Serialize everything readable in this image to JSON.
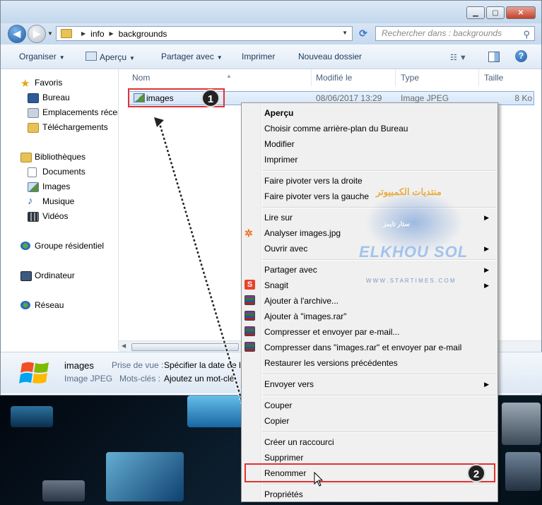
{
  "window": {
    "nav_back_icon": "back-arrow-icon",
    "nav_forward_icon": "forward-arrow-icon",
    "breadcrumb": [
      "info",
      "backgrounds"
    ],
    "search_placeholder": "Rechercher dans : backgrounds",
    "buttons": {
      "minimize": "▁",
      "maximize": "▢",
      "close": "✕"
    }
  },
  "toolbar": {
    "organise": "Organiser",
    "preview": "Aperçu",
    "share": "Partager avec",
    "print": "Imprimer",
    "new_folder": "Nouveau dossier"
  },
  "sidebar": {
    "favorites": "Favoris",
    "favorites_items": [
      "Bureau",
      "Emplacements récen",
      "Téléchargements"
    ],
    "libraries": "Bibliothèques",
    "libraries_items": [
      "Documents",
      "Images",
      "Musique",
      "Vidéos"
    ],
    "homegroup": "Groupe résidentiel",
    "computer": "Ordinateur",
    "network": "Réseau"
  },
  "columns": [
    "Nom",
    "Modifié le",
    "Type",
    "Taille"
  ],
  "file": {
    "name": "images",
    "modified": "08/06/2017 13:29",
    "type": "Image JPEG",
    "size": "8 Ko"
  },
  "details": {
    "name": "images",
    "type": "Image JPEG",
    "taken_label": "Prise de vue :",
    "taken_value": "Spécifier la date de la",
    "tags_label": "Mots-clés :",
    "tags_value": "Ajoutez un mot-clé"
  },
  "context_menu": {
    "preview": "Aperçu",
    "set_background": "Choisir comme arrière-plan du Bureau",
    "edit": "Modifier",
    "print": "Imprimer",
    "rotate_right": "Faire pivoter vers la droite",
    "rotate_left": "Faire pivoter vers la gauche",
    "play_on": "Lire sur",
    "scan": "Analyser images.jpg",
    "open_with": "Ouvrir avec",
    "share_with": "Partager avec",
    "snagit": "Snagit",
    "add_archive": "Ajouter à l'archive...",
    "add_rar": "Ajouter à \"images.rar\"",
    "compress_email": "Compresser et envoyer par e-mail...",
    "compress_rar_email": "Compresser dans \"images.rar\" et envoyer par e-mail",
    "restore": "Restaurer les versions précédentes",
    "send_to": "Envoyer vers",
    "cut": "Couper",
    "copy": "Copier",
    "shortcut": "Créer un raccourci",
    "delete": "Supprimer",
    "rename": "Renommer",
    "properties": "Propriétés"
  },
  "annotations": {
    "badge1": "1",
    "badge2": "2",
    "highlight_color": "#e23232"
  },
  "watermark": {
    "arabic": "منتديات الكمبيوتر",
    "brand": "ELKHOU SOL",
    "site": "W W W . S T A R T I M E S . C O M",
    "arabic_small": "ستار تايمز"
  }
}
